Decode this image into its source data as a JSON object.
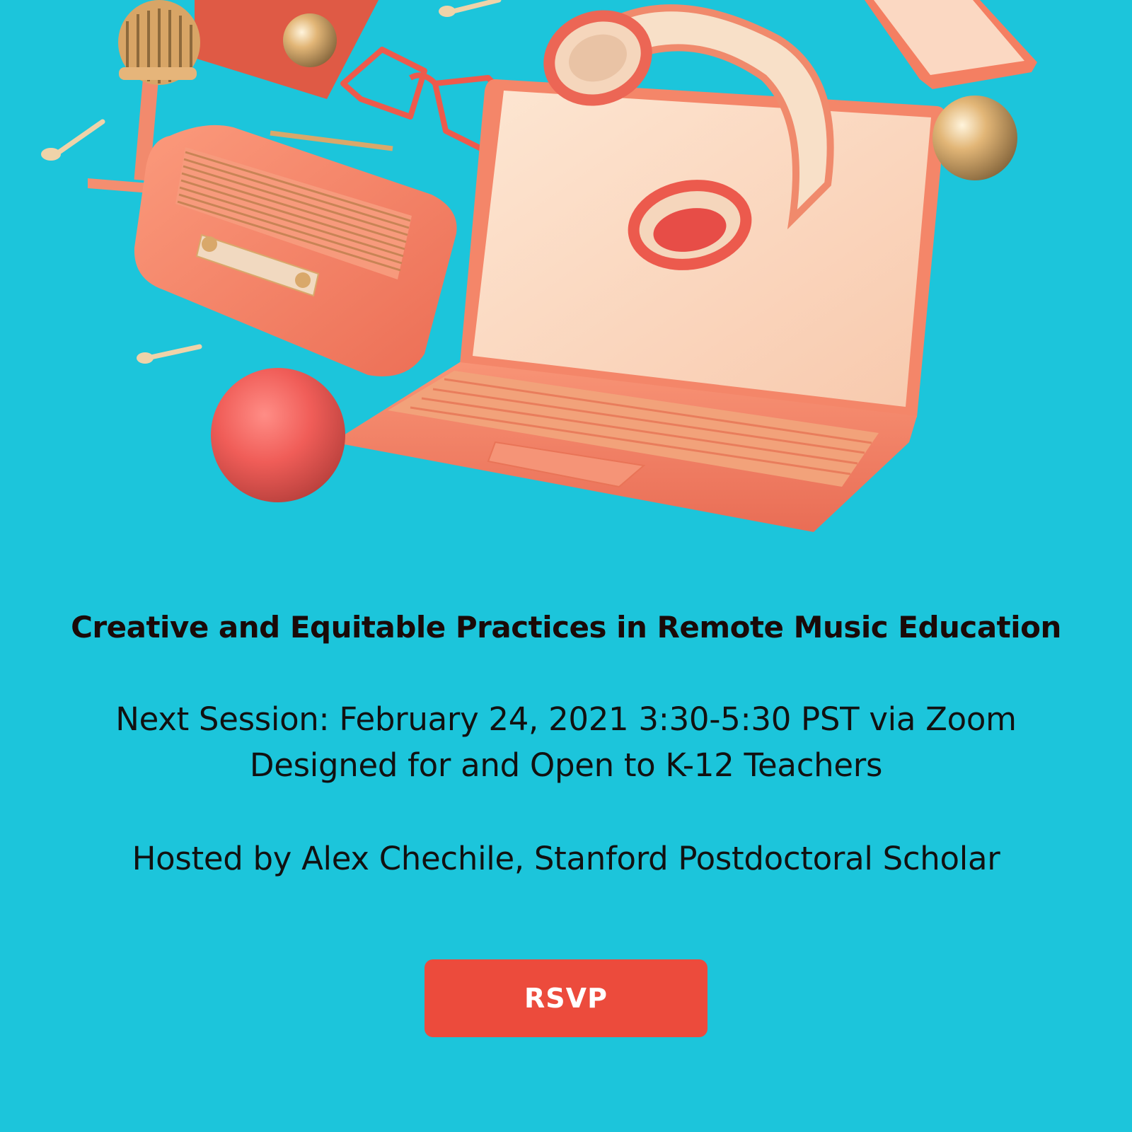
{
  "event": {
    "title": "Creative and Equitable Practices in Remote Music Education",
    "session_line": "Next Session: February 24, 2021 3:30-5:30 PST via Zoom",
    "audience_line": "Designed for and Open to K-12 Teachers",
    "host_line": "Hosted by Alex Chechile, Stanford Postdoctoral Scholar"
  },
  "cta": {
    "label": "RSVP"
  },
  "hero": {
    "objects": [
      "microphone-icon",
      "radio-icon",
      "laptop-icon",
      "headphones-icon",
      "glasses-icon",
      "music-note-icon",
      "sphere-icon",
      "phone-icon"
    ]
  },
  "colors": {
    "background": "#1cc5db",
    "coral": "#f07c62",
    "cream": "#fbdcc4",
    "gold": "#d9a86a",
    "red": "#ec4b3c",
    "button_text": "#ffffff",
    "title_text": "#1a0a08"
  }
}
